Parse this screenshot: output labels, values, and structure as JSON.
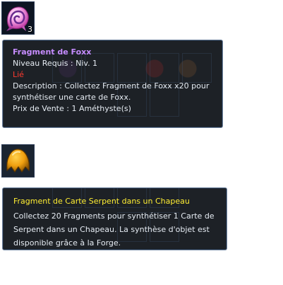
{
  "item1": {
    "icon": "pink-swirl-fragment-icon",
    "quantity": "3",
    "tooltip": {
      "name": "Fragment de Foxx",
      "level_req": "Niveau Requis : Niv. 1",
      "bound": "Lié",
      "description_line1": "Description : Collectez Fragment de Foxx x20 pour",
      "description_line2": "synthétiser une carte de Foxx.",
      "sell_price": "Prix de Vente : 1 Améthyste(s)"
    }
  },
  "item2": {
    "icon": "orange-egg-fragment-icon",
    "tooltip": {
      "name": "Fragment de Carte Serpent dans un Chapeau",
      "line1": "Collectez 20 Fragments pour synthétiser 1 Carte de",
      "line2": "Serpent dans un Chapeau. La synthèse d'objet est",
      "line3": "disponible grâce à la Forge."
    }
  },
  "colors": {
    "name_item1": "#c68cff",
    "bound": "#ff3b30",
    "name_item2": "#ffee33",
    "body_text": "#e6ecf3"
  }
}
